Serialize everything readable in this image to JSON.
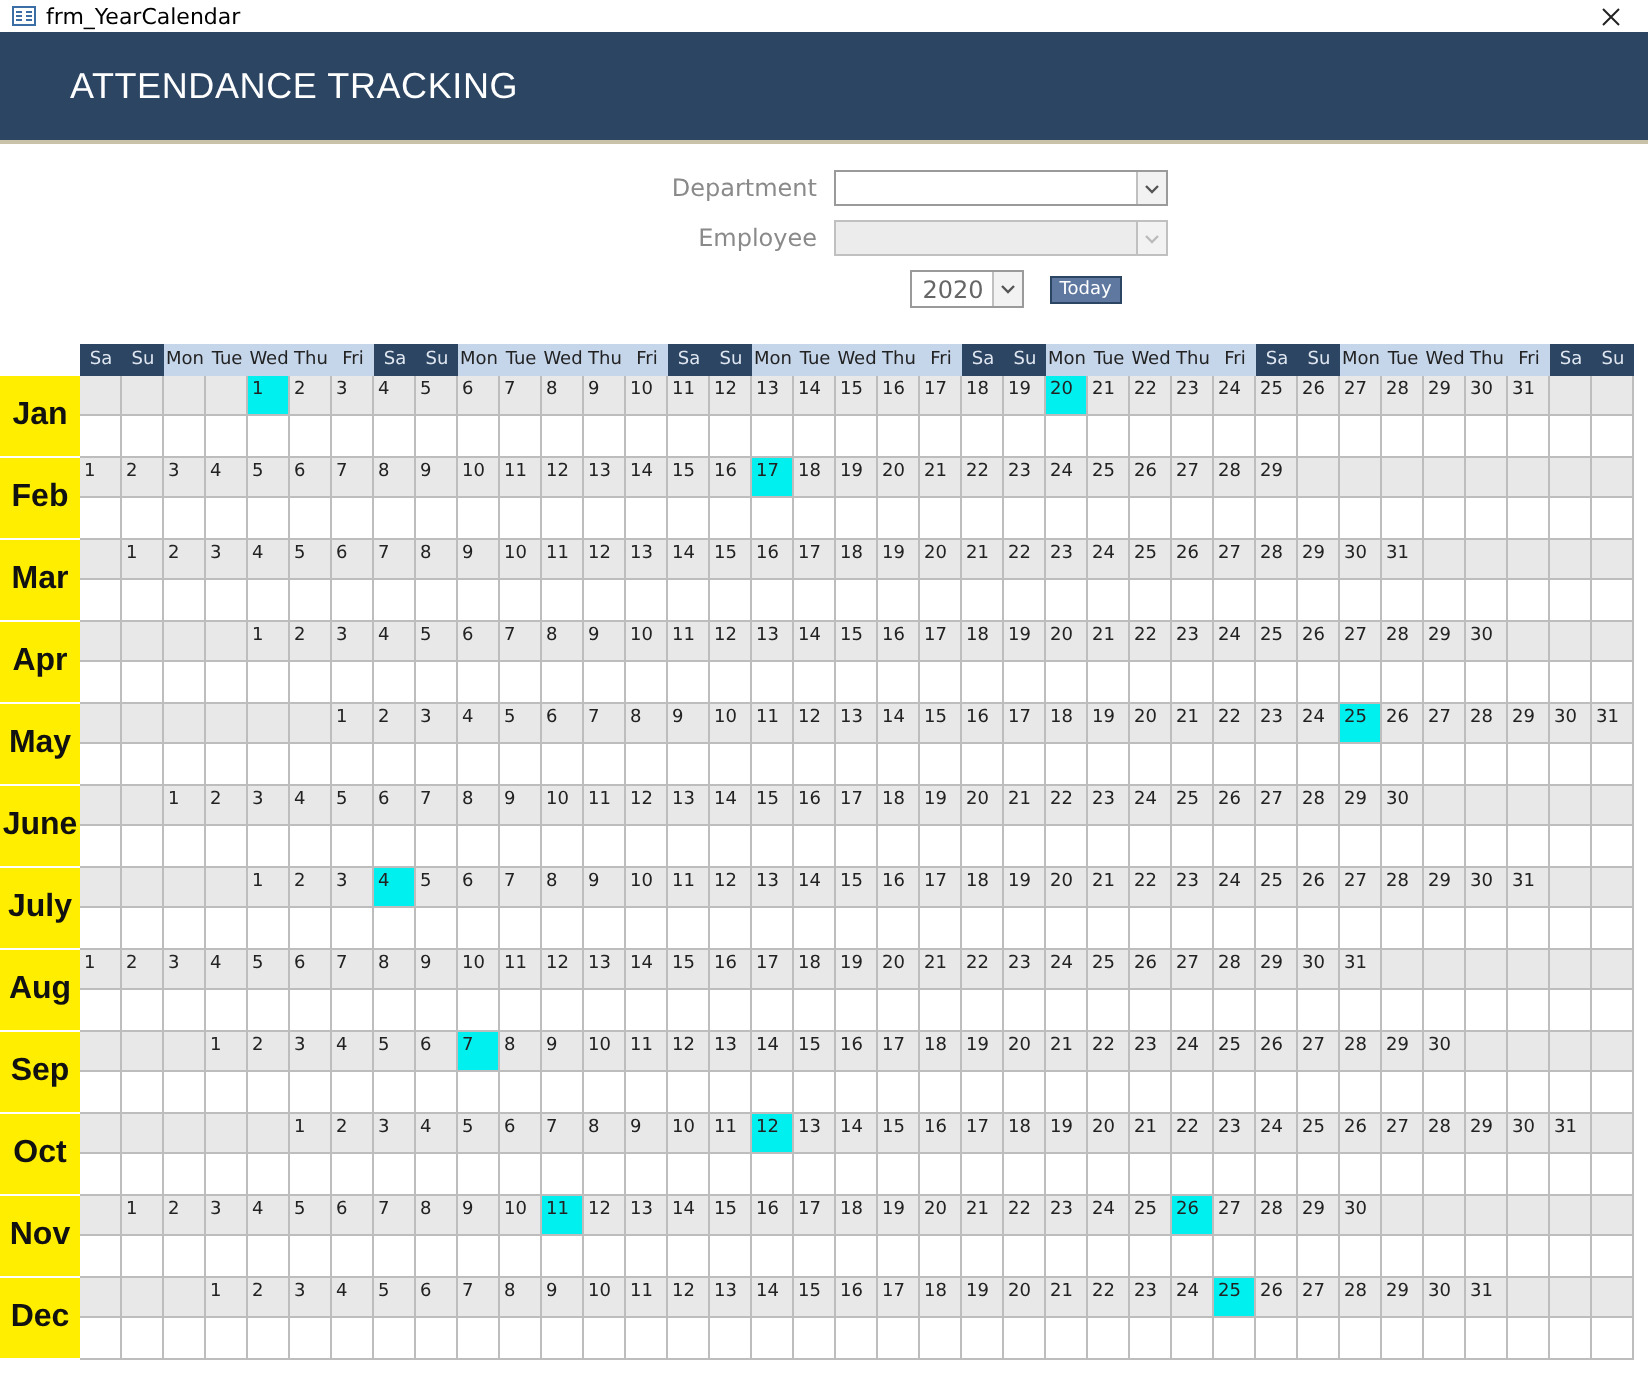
{
  "window": {
    "title": "frm_YearCalendar"
  },
  "header": {
    "title": "ATTENDANCE TRACKING"
  },
  "filters": [
    {
      "label": "Department",
      "disabled": false
    },
    {
      "label": "Employee",
      "disabled": true
    }
  ],
  "year": {
    "value": "2020"
  },
  "today_button": {
    "label": "Today"
  },
  "weekday_headers": [
    {
      "label": "Sa",
      "kind": "weekend"
    },
    {
      "label": "Su",
      "kind": "weekend"
    },
    {
      "label": "Mon",
      "kind": "weekday"
    },
    {
      "label": "Tue",
      "kind": "weekday"
    },
    {
      "label": "Wed",
      "kind": "weekday"
    },
    {
      "label": "Thu",
      "kind": "weekday"
    },
    {
      "label": "Fri",
      "kind": "weekday"
    },
    {
      "label": "Sa",
      "kind": "weekend"
    },
    {
      "label": "Su",
      "kind": "weekend"
    },
    {
      "label": "Mon",
      "kind": "weekday"
    },
    {
      "label": "Tue",
      "kind": "weekday"
    },
    {
      "label": "Wed",
      "kind": "weekday"
    },
    {
      "label": "Thu",
      "kind": "weekday"
    },
    {
      "label": "Fri",
      "kind": "weekday"
    },
    {
      "label": "Sa",
      "kind": "weekend"
    },
    {
      "label": "Su",
      "kind": "weekend"
    },
    {
      "label": "Mon",
      "kind": "weekday"
    },
    {
      "label": "Tue",
      "kind": "weekday"
    },
    {
      "label": "Wed",
      "kind": "weekday"
    },
    {
      "label": "Thu",
      "kind": "weekday"
    },
    {
      "label": "Fri",
      "kind": "weekday"
    },
    {
      "label": "Sa",
      "kind": "weekend"
    },
    {
      "label": "Su",
      "kind": "weekend"
    },
    {
      "label": "Mon",
      "kind": "weekday"
    },
    {
      "label": "Tue",
      "kind": "weekday"
    },
    {
      "label": "Wed",
      "kind": "weekday"
    },
    {
      "label": "Thu",
      "kind": "weekday"
    },
    {
      "label": "Fri",
      "kind": "weekday"
    },
    {
      "label": "Sa",
      "kind": "weekend"
    },
    {
      "label": "Su",
      "kind": "weekend"
    },
    {
      "label": "Mon",
      "kind": "weekday"
    },
    {
      "label": "Tue",
      "kind": "weekday"
    },
    {
      "label": "Wed",
      "kind": "weekday"
    },
    {
      "label": "Thu",
      "kind": "weekday"
    },
    {
      "label": "Fri",
      "kind": "weekday"
    },
    {
      "label": "Sa",
      "kind": "weekend"
    },
    {
      "label": "Su",
      "kind": "weekend"
    }
  ],
  "months": [
    {
      "name": "Jan",
      "cells": [
        null,
        null,
        null,
        null,
        {
          "day": "1",
          "highlighted": true
        },
        {
          "day": "2",
          "highlighted": false
        },
        {
          "day": "3",
          "highlighted": false
        },
        {
          "day": "4",
          "highlighted": false
        },
        {
          "day": "5",
          "highlighted": false
        },
        {
          "day": "6",
          "highlighted": false
        },
        {
          "day": "7",
          "highlighted": false
        },
        {
          "day": "8",
          "highlighted": false
        },
        {
          "day": "9",
          "highlighted": false
        },
        {
          "day": "10",
          "highlighted": false
        },
        {
          "day": "11",
          "highlighted": false
        },
        {
          "day": "12",
          "highlighted": false
        },
        {
          "day": "13",
          "highlighted": false
        },
        {
          "day": "14",
          "highlighted": false
        },
        {
          "day": "15",
          "highlighted": false
        },
        {
          "day": "16",
          "highlighted": false
        },
        {
          "day": "17",
          "highlighted": false
        },
        {
          "day": "18",
          "highlighted": false
        },
        {
          "day": "19",
          "highlighted": false
        },
        {
          "day": "20",
          "highlighted": true
        },
        {
          "day": "21",
          "highlighted": false
        },
        {
          "day": "22",
          "highlighted": false
        },
        {
          "day": "23",
          "highlighted": false
        },
        {
          "day": "24",
          "highlighted": false
        },
        {
          "day": "25",
          "highlighted": false
        },
        {
          "day": "26",
          "highlighted": false
        },
        {
          "day": "27",
          "highlighted": false
        },
        {
          "day": "28",
          "highlighted": false
        },
        {
          "day": "29",
          "highlighted": false
        },
        {
          "day": "30",
          "highlighted": false
        },
        {
          "day": "31",
          "highlighted": false
        }
      ]
    },
    {
      "name": "Feb",
      "cells": [
        {
          "day": "1",
          "highlighted": false
        },
        {
          "day": "2",
          "highlighted": false
        },
        {
          "day": "3",
          "highlighted": false
        },
        {
          "day": "4",
          "highlighted": false
        },
        {
          "day": "5",
          "highlighted": false
        },
        {
          "day": "6",
          "highlighted": false
        },
        {
          "day": "7",
          "highlighted": false
        },
        {
          "day": "8",
          "highlighted": false
        },
        {
          "day": "9",
          "highlighted": false
        },
        {
          "day": "10",
          "highlighted": false
        },
        {
          "day": "11",
          "highlighted": false
        },
        {
          "day": "12",
          "highlighted": false
        },
        {
          "day": "13",
          "highlighted": false
        },
        {
          "day": "14",
          "highlighted": false
        },
        {
          "day": "15",
          "highlighted": false
        },
        {
          "day": "16",
          "highlighted": false
        },
        {
          "day": "17",
          "highlighted": true
        },
        {
          "day": "18",
          "highlighted": false
        },
        {
          "day": "19",
          "highlighted": false
        },
        {
          "day": "20",
          "highlighted": false
        },
        {
          "day": "21",
          "highlighted": false
        },
        {
          "day": "22",
          "highlighted": false
        },
        {
          "day": "23",
          "highlighted": false
        },
        {
          "day": "24",
          "highlighted": false
        },
        {
          "day": "25",
          "highlighted": false
        },
        {
          "day": "26",
          "highlighted": false
        },
        {
          "day": "27",
          "highlighted": false
        },
        {
          "day": "28",
          "highlighted": false
        },
        {
          "day": "29",
          "highlighted": false
        }
      ]
    },
    {
      "name": "Mar",
      "cells": [
        null,
        {
          "day": "1",
          "highlighted": false
        },
        {
          "day": "2",
          "highlighted": false
        },
        {
          "day": "3",
          "highlighted": false
        },
        {
          "day": "4",
          "highlighted": false
        },
        {
          "day": "5",
          "highlighted": false
        },
        {
          "day": "6",
          "highlighted": false
        },
        {
          "day": "7",
          "highlighted": false
        },
        {
          "day": "8",
          "highlighted": false
        },
        {
          "day": "9",
          "highlighted": false
        },
        {
          "day": "10",
          "highlighted": false
        },
        {
          "day": "11",
          "highlighted": false
        },
        {
          "day": "12",
          "highlighted": false
        },
        {
          "day": "13",
          "highlighted": false
        },
        {
          "day": "14",
          "highlighted": false
        },
        {
          "day": "15",
          "highlighted": false
        },
        {
          "day": "16",
          "highlighted": false
        },
        {
          "day": "17",
          "highlighted": false
        },
        {
          "day": "18",
          "highlighted": false
        },
        {
          "day": "19",
          "highlighted": false
        },
        {
          "day": "20",
          "highlighted": false
        },
        {
          "day": "21",
          "highlighted": false
        },
        {
          "day": "22",
          "highlighted": false
        },
        {
          "day": "23",
          "highlighted": false
        },
        {
          "day": "24",
          "highlighted": false
        },
        {
          "day": "25",
          "highlighted": false
        },
        {
          "day": "26",
          "highlighted": false
        },
        {
          "day": "27",
          "highlighted": false
        },
        {
          "day": "28",
          "highlighted": false
        },
        {
          "day": "29",
          "highlighted": false
        },
        {
          "day": "30",
          "highlighted": false
        },
        {
          "day": "31",
          "highlighted": false
        }
      ]
    },
    {
      "name": "Apr",
      "cells": [
        null,
        null,
        null,
        null,
        {
          "day": "1",
          "highlighted": false
        },
        {
          "day": "2",
          "highlighted": false
        },
        {
          "day": "3",
          "highlighted": false
        },
        {
          "day": "4",
          "highlighted": false
        },
        {
          "day": "5",
          "highlighted": false
        },
        {
          "day": "6",
          "highlighted": false
        },
        {
          "day": "7",
          "highlighted": false
        },
        {
          "day": "8",
          "highlighted": false
        },
        {
          "day": "9",
          "highlighted": false
        },
        {
          "day": "10",
          "highlighted": false
        },
        {
          "day": "11",
          "highlighted": false
        },
        {
          "day": "12",
          "highlighted": false
        },
        {
          "day": "13",
          "highlighted": false
        },
        {
          "day": "14",
          "highlighted": false
        },
        {
          "day": "15",
          "highlighted": false
        },
        {
          "day": "16",
          "highlighted": false
        },
        {
          "day": "17",
          "highlighted": false
        },
        {
          "day": "18",
          "highlighted": false
        },
        {
          "day": "19",
          "highlighted": false
        },
        {
          "day": "20",
          "highlighted": false
        },
        {
          "day": "21",
          "highlighted": false
        },
        {
          "day": "22",
          "highlighted": false
        },
        {
          "day": "23",
          "highlighted": false
        },
        {
          "day": "24",
          "highlighted": false
        },
        {
          "day": "25",
          "highlighted": false
        },
        {
          "day": "26",
          "highlighted": false
        },
        {
          "day": "27",
          "highlighted": false
        },
        {
          "day": "28",
          "highlighted": false
        },
        {
          "day": "29",
          "highlighted": false
        },
        {
          "day": "30",
          "highlighted": false
        }
      ]
    },
    {
      "name": "May",
      "cells": [
        null,
        null,
        null,
        null,
        null,
        null,
        {
          "day": "1",
          "highlighted": false
        },
        {
          "day": "2",
          "highlighted": false
        },
        {
          "day": "3",
          "highlighted": false
        },
        {
          "day": "4",
          "highlighted": false
        },
        {
          "day": "5",
          "highlighted": false
        },
        {
          "day": "6",
          "highlighted": false
        },
        {
          "day": "7",
          "highlighted": false
        },
        {
          "day": "8",
          "highlighted": false
        },
        {
          "day": "9",
          "highlighted": false
        },
        {
          "day": "10",
          "highlighted": false
        },
        {
          "day": "11",
          "highlighted": false
        },
        {
          "day": "12",
          "highlighted": false
        },
        {
          "day": "13",
          "highlighted": false
        },
        {
          "day": "14",
          "highlighted": false
        },
        {
          "day": "15",
          "highlighted": false
        },
        {
          "day": "16",
          "highlighted": false
        },
        {
          "day": "17",
          "highlighted": false
        },
        {
          "day": "18",
          "highlighted": false
        },
        {
          "day": "19",
          "highlighted": false
        },
        {
          "day": "20",
          "highlighted": false
        },
        {
          "day": "21",
          "highlighted": false
        },
        {
          "day": "22",
          "highlighted": false
        },
        {
          "day": "23",
          "highlighted": false
        },
        {
          "day": "24",
          "highlighted": false
        },
        {
          "day": "25",
          "highlighted": true
        },
        {
          "day": "26",
          "highlighted": false
        },
        {
          "day": "27",
          "highlighted": false
        },
        {
          "day": "28",
          "highlighted": false
        },
        {
          "day": "29",
          "highlighted": false
        },
        {
          "day": "30",
          "highlighted": false
        },
        {
          "day": "31",
          "highlighted": false
        }
      ]
    },
    {
      "name": "June",
      "cells": [
        null,
        null,
        {
          "day": "1",
          "highlighted": false
        },
        {
          "day": "2",
          "highlighted": false
        },
        {
          "day": "3",
          "highlighted": false
        },
        {
          "day": "4",
          "highlighted": false
        },
        {
          "day": "5",
          "highlighted": false
        },
        {
          "day": "6",
          "highlighted": false
        },
        {
          "day": "7",
          "highlighted": false
        },
        {
          "day": "8",
          "highlighted": false
        },
        {
          "day": "9",
          "highlighted": false
        },
        {
          "day": "10",
          "highlighted": false
        },
        {
          "day": "11",
          "highlighted": false
        },
        {
          "day": "12",
          "highlighted": false
        },
        {
          "day": "13",
          "highlighted": false
        },
        {
          "day": "14",
          "highlighted": false
        },
        {
          "day": "15",
          "highlighted": false
        },
        {
          "day": "16",
          "highlighted": false
        },
        {
          "day": "17",
          "highlighted": false
        },
        {
          "day": "18",
          "highlighted": false
        },
        {
          "day": "19",
          "highlighted": false
        },
        {
          "day": "20",
          "highlighted": false
        },
        {
          "day": "21",
          "highlighted": false
        },
        {
          "day": "22",
          "highlighted": false
        },
        {
          "day": "23",
          "highlighted": false
        },
        {
          "day": "24",
          "highlighted": false
        },
        {
          "day": "25",
          "highlighted": false
        },
        {
          "day": "26",
          "highlighted": false
        },
        {
          "day": "27",
          "highlighted": false
        },
        {
          "day": "28",
          "highlighted": false
        },
        {
          "day": "29",
          "highlighted": false
        },
        {
          "day": "30",
          "highlighted": false
        }
      ]
    },
    {
      "name": "July",
      "cells": [
        null,
        null,
        null,
        null,
        {
          "day": "1",
          "highlighted": false
        },
        {
          "day": "2",
          "highlighted": false
        },
        {
          "day": "3",
          "highlighted": false
        },
        {
          "day": "4",
          "highlighted": true
        },
        {
          "day": "5",
          "highlighted": false
        },
        {
          "day": "6",
          "highlighted": false
        },
        {
          "day": "7",
          "highlighted": false
        },
        {
          "day": "8",
          "highlighted": false
        },
        {
          "day": "9",
          "highlighted": false
        },
        {
          "day": "10",
          "highlighted": false
        },
        {
          "day": "11",
          "highlighted": false
        },
        {
          "day": "12",
          "highlighted": false
        },
        {
          "day": "13",
          "highlighted": false
        },
        {
          "day": "14",
          "highlighted": false
        },
        {
          "day": "15",
          "highlighted": false
        },
        {
          "day": "16",
          "highlighted": false
        },
        {
          "day": "17",
          "highlighted": false
        },
        {
          "day": "18",
          "highlighted": false
        },
        {
          "day": "19",
          "highlighted": false
        },
        {
          "day": "20",
          "highlighted": false
        },
        {
          "day": "21",
          "highlighted": false
        },
        {
          "day": "22",
          "highlighted": false
        },
        {
          "day": "23",
          "highlighted": false
        },
        {
          "day": "24",
          "highlighted": false
        },
        {
          "day": "25",
          "highlighted": false
        },
        {
          "day": "26",
          "highlighted": false
        },
        {
          "day": "27",
          "highlighted": false
        },
        {
          "day": "28",
          "highlighted": false
        },
        {
          "day": "29",
          "highlighted": false
        },
        {
          "day": "30",
          "highlighted": false
        },
        {
          "day": "31",
          "highlighted": false
        }
      ]
    },
    {
      "name": "Aug",
      "cells": [
        {
          "day": "1",
          "highlighted": false
        },
        {
          "day": "2",
          "highlighted": false
        },
        {
          "day": "3",
          "highlighted": false
        },
        {
          "day": "4",
          "highlighted": false
        },
        {
          "day": "5",
          "highlighted": false
        },
        {
          "day": "6",
          "highlighted": false
        },
        {
          "day": "7",
          "highlighted": false
        },
        {
          "day": "8",
          "highlighted": false
        },
        {
          "day": "9",
          "highlighted": false
        },
        {
          "day": "10",
          "highlighted": false
        },
        {
          "day": "11",
          "highlighted": false
        },
        {
          "day": "12",
          "highlighted": false
        },
        {
          "day": "13",
          "highlighted": false
        },
        {
          "day": "14",
          "highlighted": false
        },
        {
          "day": "15",
          "highlighted": false
        },
        {
          "day": "16",
          "highlighted": false
        },
        {
          "day": "17",
          "highlighted": false
        },
        {
          "day": "18",
          "highlighted": false
        },
        {
          "day": "19",
          "highlighted": false
        },
        {
          "day": "20",
          "highlighted": false
        },
        {
          "day": "21",
          "highlighted": false
        },
        {
          "day": "22",
          "highlighted": false
        },
        {
          "day": "23",
          "highlighted": false
        },
        {
          "day": "24",
          "highlighted": false
        },
        {
          "day": "25",
          "highlighted": false
        },
        {
          "day": "26",
          "highlighted": false
        },
        {
          "day": "27",
          "highlighted": false
        },
        {
          "day": "28",
          "highlighted": false
        },
        {
          "day": "29",
          "highlighted": false
        },
        {
          "day": "30",
          "highlighted": false
        },
        {
          "day": "31",
          "highlighted": false
        }
      ]
    },
    {
      "name": "Sep",
      "cells": [
        null,
        null,
        null,
        {
          "day": "1",
          "highlighted": false
        },
        {
          "day": "2",
          "highlighted": false
        },
        {
          "day": "3",
          "highlighted": false
        },
        {
          "day": "4",
          "highlighted": false
        },
        {
          "day": "5",
          "highlighted": false
        },
        {
          "day": "6",
          "highlighted": false
        },
        {
          "day": "7",
          "highlighted": true
        },
        {
          "day": "8",
          "highlighted": false
        },
        {
          "day": "9",
          "highlighted": false
        },
        {
          "day": "10",
          "highlighted": false
        },
        {
          "day": "11",
          "highlighted": false
        },
        {
          "day": "12",
          "highlighted": false
        },
        {
          "day": "13",
          "highlighted": false
        },
        {
          "day": "14",
          "highlighted": false
        },
        {
          "day": "15",
          "highlighted": false
        },
        {
          "day": "16",
          "highlighted": false
        },
        {
          "day": "17",
          "highlighted": false
        },
        {
          "day": "18",
          "highlighted": false
        },
        {
          "day": "19",
          "highlighted": false
        },
        {
          "day": "20",
          "highlighted": false
        },
        {
          "day": "21",
          "highlighted": false
        },
        {
          "day": "22",
          "highlighted": false
        },
        {
          "day": "23",
          "highlighted": false
        },
        {
          "day": "24",
          "highlighted": false
        },
        {
          "day": "25",
          "highlighted": false
        },
        {
          "day": "26",
          "highlighted": false
        },
        {
          "day": "27",
          "highlighted": false
        },
        {
          "day": "28",
          "highlighted": false
        },
        {
          "day": "29",
          "highlighted": false
        },
        {
          "day": "30",
          "highlighted": false
        }
      ]
    },
    {
      "name": "Oct",
      "cells": [
        null,
        null,
        null,
        null,
        null,
        {
          "day": "1",
          "highlighted": false
        },
        {
          "day": "2",
          "highlighted": false
        },
        {
          "day": "3",
          "highlighted": false
        },
        {
          "day": "4",
          "highlighted": false
        },
        {
          "day": "5",
          "highlighted": false
        },
        {
          "day": "6",
          "highlighted": false
        },
        {
          "day": "7",
          "highlighted": false
        },
        {
          "day": "8",
          "highlighted": false
        },
        {
          "day": "9",
          "highlighted": false
        },
        {
          "day": "10",
          "highlighted": false
        },
        {
          "day": "11",
          "highlighted": false
        },
        {
          "day": "12",
          "highlighted": true
        },
        {
          "day": "13",
          "highlighted": false
        },
        {
          "day": "14",
          "highlighted": false
        },
        {
          "day": "15",
          "highlighted": false
        },
        {
          "day": "16",
          "highlighted": false
        },
        {
          "day": "17",
          "highlighted": false
        },
        {
          "day": "18",
          "highlighted": false
        },
        {
          "day": "19",
          "highlighted": false
        },
        {
          "day": "20",
          "highlighted": false
        },
        {
          "day": "21",
          "highlighted": false
        },
        {
          "day": "22",
          "highlighted": false
        },
        {
          "day": "23",
          "highlighted": false
        },
        {
          "day": "24",
          "highlighted": false
        },
        {
          "day": "25",
          "highlighted": false
        },
        {
          "day": "26",
          "highlighted": false
        },
        {
          "day": "27",
          "highlighted": false
        },
        {
          "day": "28",
          "highlighted": false
        },
        {
          "day": "29",
          "highlighted": false
        },
        {
          "day": "30",
          "highlighted": false
        },
        {
          "day": "31",
          "highlighted": false
        }
      ]
    },
    {
      "name": "Nov",
      "cells": [
        null,
        {
          "day": "1",
          "highlighted": false
        },
        {
          "day": "2",
          "highlighted": false
        },
        {
          "day": "3",
          "highlighted": false
        },
        {
          "day": "4",
          "highlighted": false
        },
        {
          "day": "5",
          "highlighted": false
        },
        {
          "day": "6",
          "highlighted": false
        },
        {
          "day": "7",
          "highlighted": false
        },
        {
          "day": "8",
          "highlighted": false
        },
        {
          "day": "9",
          "highlighted": false
        },
        {
          "day": "10",
          "highlighted": false
        },
        {
          "day": "11",
          "highlighted": true
        },
        {
          "day": "12",
          "highlighted": false
        },
        {
          "day": "13",
          "highlighted": false
        },
        {
          "day": "14",
          "highlighted": false
        },
        {
          "day": "15",
          "highlighted": false
        },
        {
          "day": "16",
          "highlighted": false
        },
        {
          "day": "17",
          "highlighted": false
        },
        {
          "day": "18",
          "highlighted": false
        },
        {
          "day": "19",
          "highlighted": false
        },
        {
          "day": "20",
          "highlighted": false
        },
        {
          "day": "21",
          "highlighted": false
        },
        {
          "day": "22",
          "highlighted": false
        },
        {
          "day": "23",
          "highlighted": false
        },
        {
          "day": "24",
          "highlighted": false
        },
        {
          "day": "25",
          "highlighted": false
        },
        {
          "day": "26",
          "highlighted": true
        },
        {
          "day": "27",
          "highlighted": false
        },
        {
          "day": "28",
          "highlighted": false
        },
        {
          "day": "29",
          "highlighted": false
        },
        {
          "day": "30",
          "highlighted": false
        }
      ]
    },
    {
      "name": "Dec",
      "cells": [
        null,
        null,
        null,
        {
          "day": "1",
          "highlighted": false
        },
        {
          "day": "2",
          "highlighted": false
        },
        {
          "day": "3",
          "highlighted": false
        },
        {
          "day": "4",
          "highlighted": false
        },
        {
          "day": "5",
          "highlighted": false
        },
        {
          "day": "6",
          "highlighted": false
        },
        {
          "day": "7",
          "highlighted": false
        },
        {
          "day": "8",
          "highlighted": false
        },
        {
          "day": "9",
          "highlighted": false
        },
        {
          "day": "10",
          "highlighted": false
        },
        {
          "day": "11",
          "highlighted": false
        },
        {
          "day": "12",
          "highlighted": false
        },
        {
          "day": "13",
          "highlighted": false
        },
        {
          "day": "14",
          "highlighted": false
        },
        {
          "day": "15",
          "highlighted": false
        },
        {
          "day": "16",
          "highlighted": false
        },
        {
          "day": "17",
          "highlighted": false
        },
        {
          "day": "18",
          "highlighted": false
        },
        {
          "day": "19",
          "highlighted": false
        },
        {
          "day": "20",
          "highlighted": false
        },
        {
          "day": "21",
          "highlighted": false
        },
        {
          "day": "22",
          "highlighted": false
        },
        {
          "day": "23",
          "highlighted": false
        },
        {
          "day": "24",
          "highlighted": false
        },
        {
          "day": "25",
          "highlighted": true
        },
        {
          "day": "26",
          "highlighted": false
        },
        {
          "day": "27",
          "highlighted": false
        },
        {
          "day": "28",
          "highlighted": false
        },
        {
          "day": "29",
          "highlighted": false
        },
        {
          "day": "30",
          "highlighted": false
        },
        {
          "day": "31",
          "highlighted": false
        }
      ]
    }
  ]
}
